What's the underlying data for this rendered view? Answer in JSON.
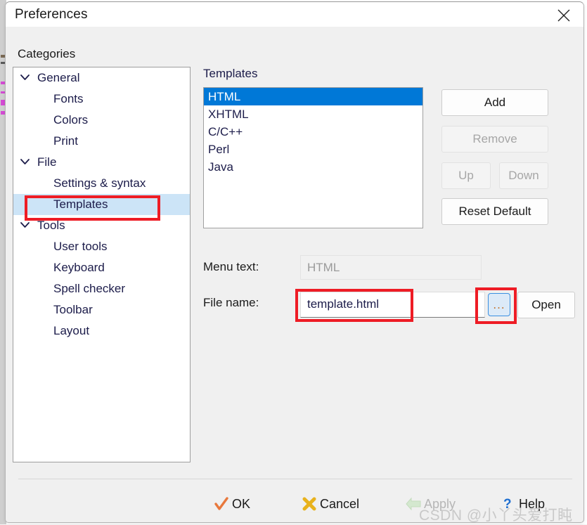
{
  "window": {
    "title": "Preferences",
    "close_icon": "close-icon"
  },
  "categories": {
    "label": "Categories",
    "items": [
      {
        "label": "General",
        "level": 0,
        "expanded": true,
        "selected": false
      },
      {
        "label": "Fonts",
        "level": 1,
        "expanded": null,
        "selected": false
      },
      {
        "label": "Colors",
        "level": 1,
        "expanded": null,
        "selected": false
      },
      {
        "label": "Print",
        "level": 1,
        "expanded": null,
        "selected": false
      },
      {
        "label": "File",
        "level": 0,
        "expanded": true,
        "selected": false
      },
      {
        "label": "Settings & syntax",
        "level": 1,
        "expanded": null,
        "selected": false
      },
      {
        "label": "Templates",
        "level": 1,
        "expanded": null,
        "selected": true
      },
      {
        "label": "Tools",
        "level": 0,
        "expanded": true,
        "selected": false
      },
      {
        "label": "User tools",
        "level": 1,
        "expanded": null,
        "selected": false
      },
      {
        "label": "Keyboard",
        "level": 1,
        "expanded": null,
        "selected": false
      },
      {
        "label": "Spell checker",
        "level": 1,
        "expanded": null,
        "selected": false
      },
      {
        "label": "Toolbar",
        "level": 1,
        "expanded": null,
        "selected": false
      },
      {
        "label": "Layout",
        "level": 1,
        "expanded": null,
        "selected": false
      }
    ]
  },
  "templates": {
    "label": "Templates",
    "items": [
      {
        "label": "HTML",
        "selected": true
      },
      {
        "label": "XHTML",
        "selected": false
      },
      {
        "label": "C/C++",
        "selected": false
      },
      {
        "label": "Perl",
        "selected": false
      },
      {
        "label": "Java",
        "selected": false
      }
    ],
    "buttons": {
      "add": {
        "label": "Add",
        "enabled": true
      },
      "remove": {
        "label": "Remove",
        "enabled": false
      },
      "up": {
        "label": "Up",
        "enabled": false
      },
      "down": {
        "label": "Down",
        "enabled": false
      },
      "reset": {
        "label": "Reset Default",
        "enabled": true
      }
    }
  },
  "fields": {
    "menu_text": {
      "label": "Menu text:",
      "value": "HTML",
      "enabled": false
    },
    "file_name": {
      "label": "File name:",
      "value": "template.html",
      "enabled": true,
      "browse_label": "...",
      "open_label": "Open"
    }
  },
  "footer": {
    "ok": {
      "label": "OK",
      "icon": "check-icon",
      "enabled": true
    },
    "cancel": {
      "label": "Cancel",
      "icon": "cross-icon",
      "enabled": true
    },
    "apply": {
      "label": "Apply",
      "icon": "left-arrow-icon",
      "enabled": false
    },
    "help": {
      "label": "Help",
      "icon": "question-icon",
      "enabled": true
    }
  },
  "watermark": "CSDN @小丫头爱打盹",
  "colors": {
    "list_selection": "#0078d7",
    "tree_selection": "#cce4f7",
    "annotation": "#ee1c25",
    "focus_border": "#3a8fe0",
    "dialog_bg": "#f0f0f0"
  }
}
